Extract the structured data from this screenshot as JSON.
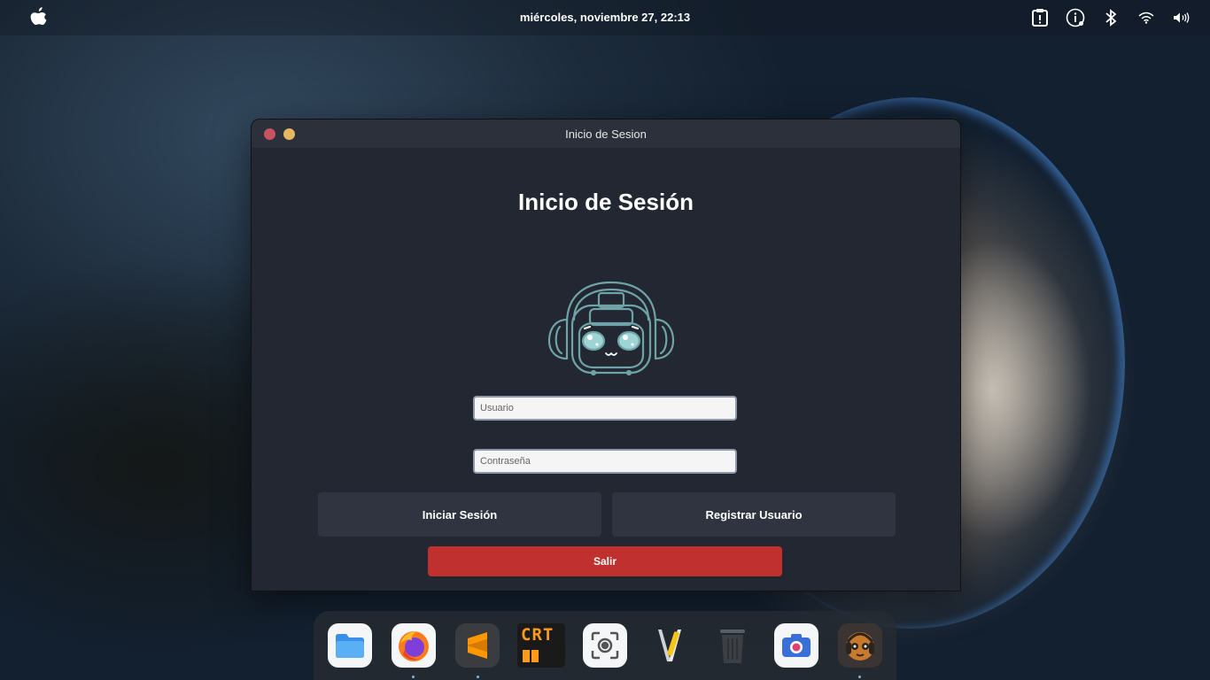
{
  "topbar": {
    "clock": "miércoles, noviembre 27, 22:13",
    "tray_icons": [
      "clipboard-icon",
      "info-icon",
      "bluetooth-icon",
      "wifi-icon",
      "volume-icon"
    ]
  },
  "window": {
    "title": "Inicio de Sesion",
    "heading": "Inicio de Sesión",
    "username_placeholder": "Usuario",
    "password_placeholder": "Contraseña",
    "login_button": "Iniciar Sesión",
    "register_button": "Registrar Usuario",
    "exit_button": "Salir"
  },
  "dock": {
    "items": [
      "files-icon",
      "firefox-icon",
      "sublime-text-icon",
      "crt-terminal-icon",
      "screenshot-icon",
      "text-editor-icon",
      "trash-icon",
      "camera-icon",
      "robot-app-icon"
    ],
    "crt_label": "CRT"
  },
  "colors": {
    "window_bg": "#222731",
    "button_bg": "#2f3440",
    "exit_bg": "#c0302f",
    "mascot_stroke": "#6ea4a8"
  }
}
